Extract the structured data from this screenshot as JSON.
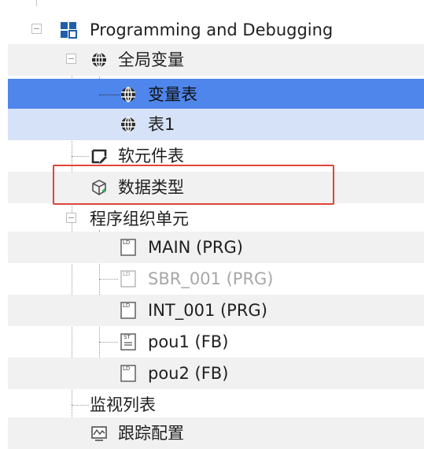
{
  "tree": {
    "root": {
      "label": "Programming and Debugging",
      "icon": "grid-icon"
    },
    "global_vars": {
      "label": "全局变量",
      "icon": "globe-icon"
    },
    "var_table": {
      "label": "变量表",
      "icon": "globe-icon",
      "selected": true
    },
    "table1": {
      "label": "表1",
      "icon": "globe-icon"
    },
    "device_table": {
      "label": "软元件表",
      "icon": "edit-table-icon"
    },
    "data_types": {
      "label": "数据类型",
      "icon": "cube-icon",
      "highlighted": true
    },
    "pou_group": {
      "label": "程序组织单元"
    },
    "pous": [
      {
        "label": "MAIN (PRG)",
        "icon_text": "LD",
        "disabled": false
      },
      {
        "label": "SBR_001 (PRG)",
        "icon_text": "LD",
        "disabled": true
      },
      {
        "label": "INT_001 (PRG)",
        "icon_text": "LD",
        "disabled": false
      },
      {
        "label": "pou1 (FB)",
        "icon_text": "ST",
        "disabled": false
      },
      {
        "label": "pou2 (FB)",
        "icon_text": "LD",
        "disabled": false
      }
    ],
    "watch_list": {
      "label": "监视列表"
    },
    "trace_config": {
      "label": "跟踪配置",
      "icon": "waveform-icon"
    }
  },
  "colors": {
    "selection": "#4f86ec",
    "secondary_selection": "#d5e2f7",
    "alt_row": "#f1f1f1",
    "highlight_border": "#e0453a"
  }
}
